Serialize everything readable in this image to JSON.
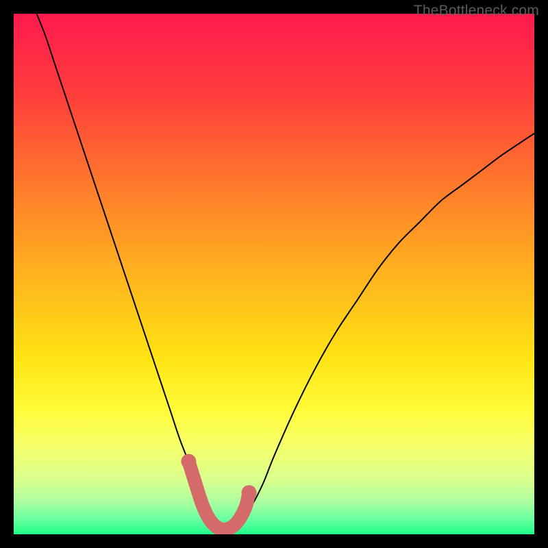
{
  "watermark": "TheBottleneck.com",
  "colors": {
    "frame_bg": "#000000",
    "gradient_stops": [
      {
        "offset": 0.0,
        "color": "#ff1a4e"
      },
      {
        "offset": 0.16,
        "color": "#ff3f3b"
      },
      {
        "offset": 0.33,
        "color": "#ff7a2c"
      },
      {
        "offset": 0.5,
        "color": "#ffb31e"
      },
      {
        "offset": 0.66,
        "color": "#ffe313"
      },
      {
        "offset": 0.76,
        "color": "#fffc38"
      },
      {
        "offset": 0.83,
        "color": "#f5ff6a"
      },
      {
        "offset": 0.9,
        "color": "#d6ff8f"
      },
      {
        "offset": 0.94,
        "color": "#a8ffa0"
      },
      {
        "offset": 0.97,
        "color": "#6bffa0"
      },
      {
        "offset": 1.0,
        "color": "#1eff88"
      }
    ],
    "curve_stroke": "#000000",
    "marker_fill": "#d46a6a"
  },
  "chart_data": {
    "type": "line",
    "title": "",
    "xlabel": "",
    "ylabel": "",
    "xlim": [
      0,
      100
    ],
    "ylim": [
      0,
      100
    ],
    "series": [
      {
        "name": "bottleneck-curve",
        "x": [
          4,
          6,
          8,
          10,
          12,
          14,
          16,
          18,
          20,
          22,
          24,
          26,
          28,
          30,
          32,
          34,
          36,
          37,
          38,
          39,
          40,
          41,
          42,
          44,
          46,
          48,
          50,
          54,
          58,
          62,
          66,
          70,
          74,
          78,
          82,
          86,
          90,
          94,
          100
        ],
        "y": [
          101,
          96,
          90,
          84,
          78,
          72,
          66,
          60,
          54,
          48,
          42,
          36,
          30,
          24,
          18,
          13,
          8,
          5,
          3,
          1.5,
          1,
          1,
          1.5,
          3,
          6,
          10,
          15,
          24,
          32,
          39,
          45,
          51,
          56,
          60,
          64,
          67,
          70,
          73,
          77
        ]
      }
    ],
    "markers": {
      "name": "highlight-segment",
      "x": [
        33.6,
        35.0,
        36.2,
        37.4,
        38.6,
        39.8,
        41.0,
        42.2,
        43.4,
        44.6,
        45.2
      ],
      "y": [
        14.0,
        9.5,
        5.8,
        3.2,
        1.7,
        1.0,
        1.0,
        1.6,
        3.0,
        5.4,
        8.0
      ]
    }
  }
}
